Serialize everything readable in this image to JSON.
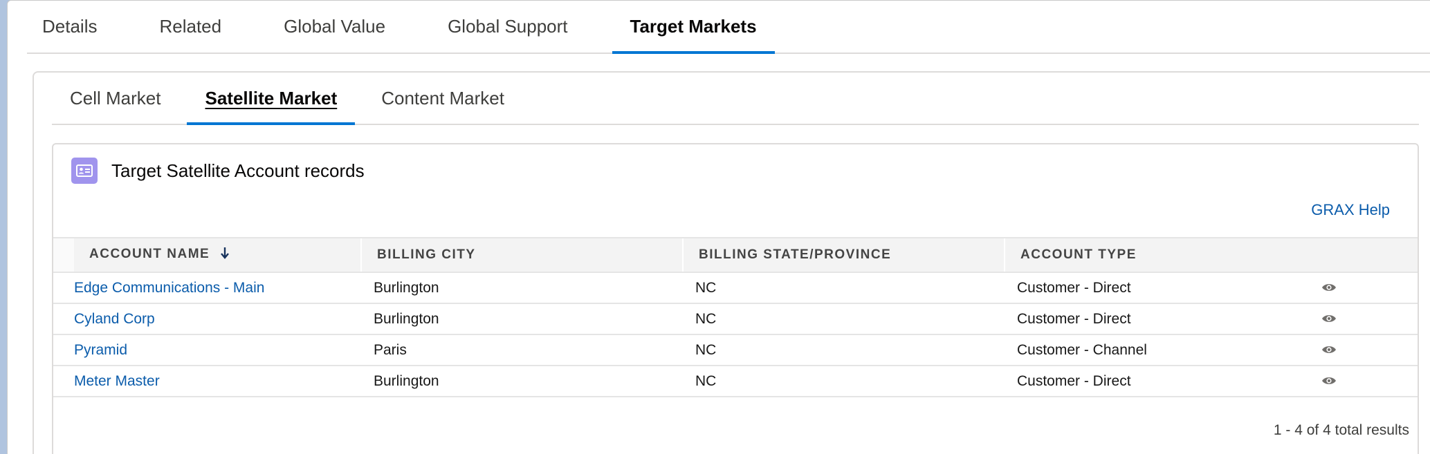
{
  "main_tabs": [
    {
      "label": "Details",
      "active": false
    },
    {
      "label": "Related",
      "active": false
    },
    {
      "label": "Global Value",
      "active": false
    },
    {
      "label": "Global Support",
      "active": false
    },
    {
      "label": "Target Markets",
      "active": true
    }
  ],
  "sub_tabs": [
    {
      "label": "Cell Market",
      "active": false
    },
    {
      "label": "Satellite Market",
      "active": true
    },
    {
      "label": "Content Market",
      "active": false
    }
  ],
  "related_list": {
    "title": "Target Satellite Account records",
    "icon": "contact-card-icon",
    "icon_color": "#a094ed",
    "help_link": "GRAX Help",
    "columns": [
      "Account Name",
      "Billing City",
      "Billing State/Province",
      "Account Type"
    ],
    "sort_column": "Account Name",
    "sort_direction": "descending",
    "rows": [
      {
        "name": "Edge Communications - Main",
        "city": "Burlington",
        "state": "NC",
        "type": "Customer - Direct"
      },
      {
        "name": "Cyland Corp",
        "city": "Burlington",
        "state": "NC",
        "type": "Customer - Direct"
      },
      {
        "name": "Pyramid",
        "city": "Paris",
        "state": "NC",
        "type": "Customer - Channel"
      },
      {
        "name": "Meter Master",
        "city": "Burlington",
        "state": "NC",
        "type": "Customer - Direct"
      }
    ],
    "row_action_icon": "eye-icon",
    "footer": "1 - 4 of 4 total results"
  },
  "colors": {
    "accent": "#0176d3",
    "link": "#0b5cab"
  }
}
